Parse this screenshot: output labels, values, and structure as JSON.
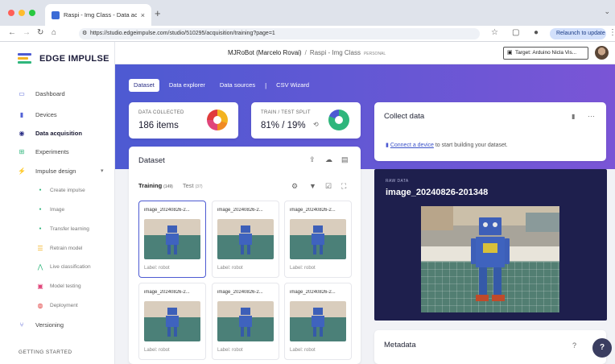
{
  "browser": {
    "tab_title": "Raspi - Img Class - Data acq...",
    "url": "https://studio.edgeimpulse.com/studio/510295/acquisition/training?page=1",
    "relaunch_label": "Relaunch to update"
  },
  "sidebar": {
    "logo_text": "EDGE IMPULSE",
    "items": [
      {
        "label": "Dashboard",
        "icon": "dashboard-icon"
      },
      {
        "label": "Devices",
        "icon": "devices-icon"
      },
      {
        "label": "Data acquisition",
        "icon": "database-icon"
      },
      {
        "label": "Experiments",
        "icon": "experiments-icon"
      },
      {
        "label": "Impulse design",
        "icon": "impulse-icon"
      },
      {
        "label": "Create impulse",
        "icon": "dot-icon"
      },
      {
        "label": "Image",
        "icon": "dot-icon"
      },
      {
        "label": "Transfer learning",
        "icon": "dot-icon"
      },
      {
        "label": "Retrain model",
        "icon": "retrain-icon"
      },
      {
        "label": "Live classification",
        "icon": "live-icon"
      },
      {
        "label": "Model testing",
        "icon": "testing-icon"
      },
      {
        "label": "Deployment",
        "icon": "deploy-icon"
      },
      {
        "label": "Versioning",
        "icon": "versioning-icon"
      }
    ],
    "getting_started": "GETTING STARTED"
  },
  "header": {
    "owner": "MJRoBot (Marcelo Rovai)",
    "project": "Raspi - Img Class",
    "badge": "PERSONAL",
    "target": "Target: Arduino Nicla Vis..."
  },
  "subnav": [
    "Dataset",
    "Data explorer",
    "Data sources",
    "CSV Wizard"
  ],
  "stats": {
    "collected_label": "DATA COLLECTED",
    "collected_value": "186 items",
    "split_label": "TRAIN / TEST SPLIT",
    "split_value": "81% / 19%",
    "split_train_fraction": 0.81
  },
  "dataset": {
    "title": "Dataset",
    "tab_training": "Training",
    "tab_training_count": "(149)",
    "tab_test": "Test",
    "tab_test_count": "(37)",
    "tiles": [
      {
        "name": "image_20240826-2...",
        "label": "Label: robot"
      },
      {
        "name": "image_20240826-2...",
        "label": "Label: robot"
      },
      {
        "name": "image_20240826-2...",
        "label": "Label: robot"
      },
      {
        "name": "image_20240826-2...",
        "label": "Label: robot"
      },
      {
        "name": "image_20240826-2...",
        "label": "Label: robot"
      },
      {
        "name": "image_20240826-2...",
        "label": "Label: robot"
      }
    ]
  },
  "collect": {
    "title": "Collect data",
    "link": "Connect a device",
    "text": "to start building your dataset."
  },
  "preview": {
    "raw_label": "RAW DATA",
    "name": "image_20240826-201348"
  },
  "metadata": {
    "title": "Metadata"
  },
  "help": "?",
  "colors": {
    "accent": "#4d5ad2",
    "dark_panel": "#1e1f4d",
    "green": "#2fb67c"
  }
}
